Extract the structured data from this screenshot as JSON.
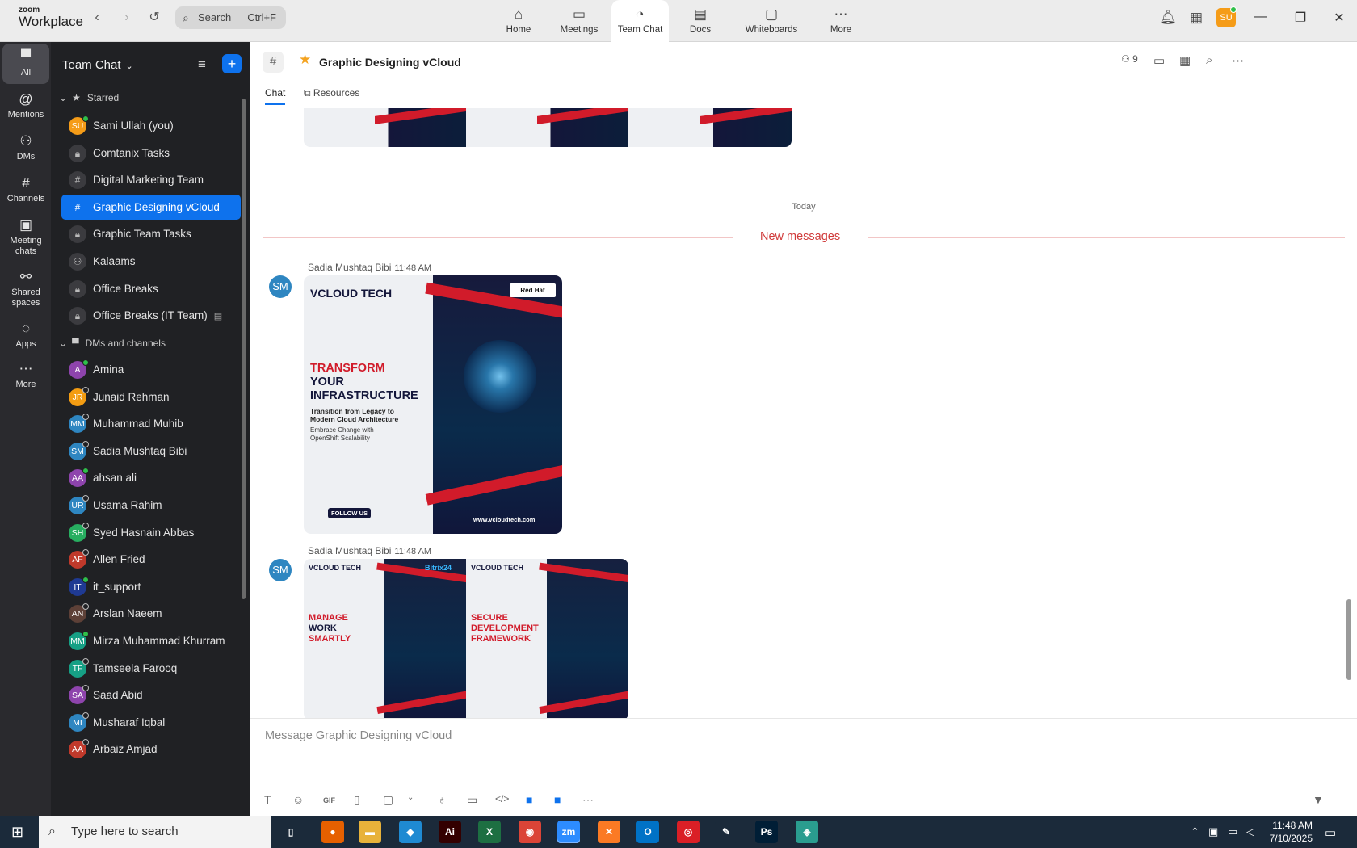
{
  "app": {
    "logo_line1": "zoom",
    "logo_line2": "Workplace",
    "search_placeholder": "Search",
    "search_shortcut": "Ctrl+F",
    "user_initials": "SU"
  },
  "tabs": [
    {
      "label": "Home",
      "icon": "home-icon"
    },
    {
      "label": "Meetings",
      "icon": "video-icon"
    },
    {
      "label": "Team Chat",
      "icon": "chat-icon"
    },
    {
      "label": "Docs",
      "icon": "docs-icon"
    },
    {
      "label": "Whiteboards",
      "icon": "whiteboard-icon"
    },
    {
      "label": "More",
      "icon": "more-icon"
    }
  ],
  "rail": [
    {
      "label": "All"
    },
    {
      "label": "Mentions"
    },
    {
      "label": "DMs"
    },
    {
      "label": "Channels"
    },
    {
      "label": "Meeting chats"
    },
    {
      "label": "Shared spaces"
    },
    {
      "label": "Apps"
    },
    {
      "label": "More"
    }
  ],
  "sidebar": {
    "title": "Team Chat",
    "starred_label": "Starred",
    "starred": [
      {
        "label": "Sami Ullah (you)",
        "initials": "SU",
        "color": "#f59c18",
        "status": "online",
        "kind": "avatar"
      },
      {
        "label": "Comtanix Tasks",
        "kind": "lock"
      },
      {
        "label": "Digital Marketing Team",
        "kind": "hash"
      },
      {
        "label": "Graphic Designing vCloud",
        "kind": "hash",
        "active": true
      },
      {
        "label": "Graphic Team Tasks",
        "kind": "lock"
      },
      {
        "label": "Kalaams",
        "kind": "group"
      },
      {
        "label": "Office Breaks",
        "kind": "lock"
      },
      {
        "label": "Office Breaks (IT Team)",
        "kind": "lock",
        "archived": true
      }
    ],
    "dms_label": "DMs and channels",
    "dms": [
      {
        "label": "Amina",
        "initials": "A",
        "color": "#8e44ad",
        "status": "online"
      },
      {
        "label": "Junaid Rehman",
        "initials": "JR",
        "color": "#f39c12",
        "status": "away"
      },
      {
        "label": "Muhammad Muhib",
        "initials": "MM",
        "color": "#2e86c1",
        "status": "away"
      },
      {
        "label": "Sadia Mushtaq Bibi",
        "initials": "SM",
        "color": "#2e86c1",
        "status": "away"
      },
      {
        "label": "ahsan ali",
        "initials": "AA",
        "color": "#8e44ad",
        "status": "online"
      },
      {
        "label": "Usama Rahim",
        "initials": "UR",
        "color": "#2e86c1",
        "status": "away"
      },
      {
        "label": "Syed Hasnain Abbas",
        "initials": "SH",
        "color": "#27ae60",
        "status": "away"
      },
      {
        "label": "Allen Fried",
        "initials": "AF",
        "color": "#c0392b",
        "status": "away"
      },
      {
        "label": "it_support",
        "initials": "IT",
        "color": "#1f3a93",
        "status": "online"
      },
      {
        "label": "Arslan Naeem",
        "initials": "AN",
        "color": "#5d4037",
        "status": "away"
      },
      {
        "label": "Mirza Muhammad Khurram",
        "initials": "MM",
        "color": "#16a085",
        "status": "online"
      },
      {
        "label": "Tamseela Farooq",
        "initials": "TF",
        "color": "#16a085",
        "status": "away"
      },
      {
        "label": "Saad Abid",
        "initials": "SA",
        "color": "#8e44ad",
        "status": "away"
      },
      {
        "label": "Musharaf Iqbal",
        "initials": "MI",
        "color": "#2e86c1",
        "status": "away"
      },
      {
        "label": "Arbaiz Amjad",
        "initials": "AA",
        "color": "#c0392b",
        "status": "away"
      }
    ]
  },
  "channel": {
    "name": "Graphic Designing vCloud",
    "members": "9",
    "tab_chat": "Chat",
    "tab_resources": "Resources",
    "today_label": "Today",
    "new_messages_label": "New messages",
    "composer_placeholder": "Message Graphic Designing vCloud",
    "gif_label": "GIF"
  },
  "messages": [
    {
      "sender": "Sadia Mushtaq Bibi",
      "time": "11:48 AM",
      "initials": "SM"
    },
    {
      "sender": "Sadia Mushtaq Bibi",
      "time": "11:48 AM",
      "initials": "SM"
    }
  ],
  "poster1": {
    "brand": "VCLOUD TECH",
    "partner": "Red Hat",
    "headline1": "TRANSFORM",
    "headline2": "YOUR",
    "headline3": "INFRASTRUCTURE",
    "sub1": "Transition from Legacy to",
    "sub2": "Modern Cloud Architecture",
    "sub3": "Embrace Change with",
    "sub4": "OpenShift Scalability",
    "follow": "FOLLOW US",
    "website": "www.vcloudtech.com"
  },
  "poster2": {
    "brand": "VCLOUD TECH",
    "partner": "Bitrix24",
    "headline1": "MANAGE",
    "headline2": "WORK",
    "headline3": "SMARTLY"
  },
  "poster3": {
    "brand": "VCLOUD TECH",
    "headline1": "SECURE",
    "headline2": "DEVELOPMENT",
    "headline3": "FRAMEWORK"
  },
  "taskbar": {
    "search_placeholder": "Type here to search",
    "time": "11:48 AM",
    "date": "7/10/2025",
    "apps": [
      {
        "name": "task-view",
        "label": "▯",
        "color": "#1b2a3a"
      },
      {
        "name": "firefox",
        "label": "●",
        "color": "#e66000"
      },
      {
        "name": "file-explorer",
        "label": "▬",
        "color": "#e8b23a"
      },
      {
        "name": "vscode",
        "label": "◆",
        "color": "#1f8ad2"
      },
      {
        "name": "illustrator",
        "label": "Ai",
        "color": "#330000"
      },
      {
        "name": "excel",
        "label": "X",
        "color": "#1d6f42"
      },
      {
        "name": "chrome",
        "label": "◉",
        "color": "#db4437"
      },
      {
        "name": "zoom",
        "label": "zm",
        "color": "#2d8cff"
      },
      {
        "name": "xampp",
        "label": "✕",
        "color": "#fb7a24"
      },
      {
        "name": "outlook",
        "label": "O",
        "color": "#0072c6"
      },
      {
        "name": "creative-cloud",
        "label": "◎",
        "color": "#da1f26"
      },
      {
        "name": "pen-tool",
        "label": "✎",
        "color": "#1b2a3a"
      },
      {
        "name": "photoshop",
        "label": "Ps",
        "color": "#001e36"
      },
      {
        "name": "app-diamond",
        "label": "◈",
        "color": "#2a9d8f"
      }
    ]
  }
}
